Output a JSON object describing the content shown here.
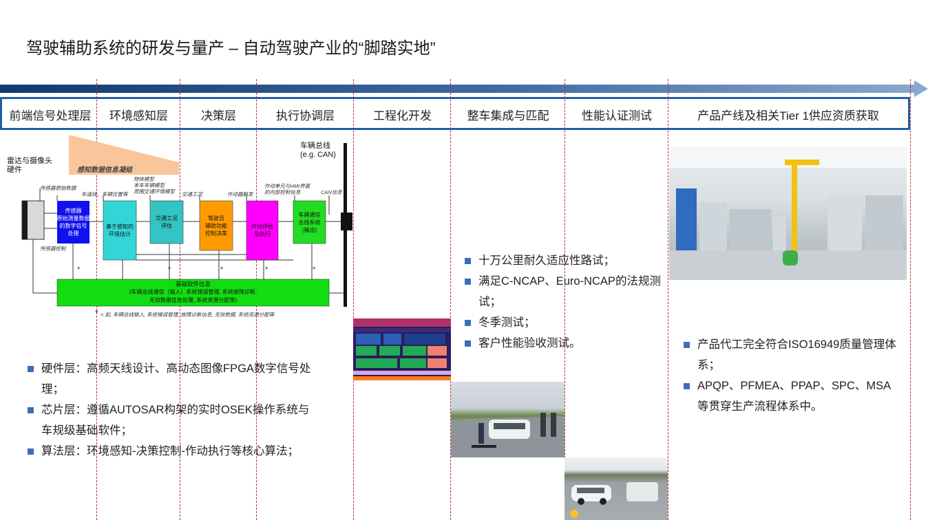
{
  "title": "驾驶辅助系统的研发与量产 – 自动驾驶产业的“脚踏实地”",
  "stages": [
    {
      "label": "前端信号处理层"
    },
    {
      "label": "环境感知层"
    },
    {
      "label": "决策层"
    },
    {
      "label": "执行协调层"
    },
    {
      "label": "工程化开发"
    },
    {
      "label": "整车集成与匹配"
    },
    {
      "label": "性能认证测试"
    },
    {
      "label": "产品产线及相关Tier 1供应资质获取"
    }
  ],
  "diagram": {
    "radar_label": "雷达与摄像头\n硬件",
    "bus_label": "车辆总线\n(e.g. CAN)",
    "fusion_label": "感知数据信息凝结",
    "sensor_raw": "传感器原始数据",
    "sensor_ctrl": "传感器控制",
    "lane_label": "车道线、车辆位置等",
    "object_label": "物体模型\n本车车辆模型\n周围交通环境模型",
    "traffic_label": "交通工况",
    "action_label": "作动器触发",
    "hmi_label": "作动单元与HMI界面\n的内部控制信息",
    "can_info": "CAN信息",
    "box1": "传感器\n原始测量数据\n的数字信号\n处理",
    "box2": "基于感知的\n环境估计",
    "box3": "交通工况\n评估",
    "box4": "驾驶员\n辅助功能\n控制决策",
    "box5": "作动评估\n及执行",
    "box6": "车辆通信\n总线系统\n(输出)",
    "base_title": "基础软件信息",
    "base_line1": "(车辆总线通信（输入）系统错误管理, 系统故障诊断,",
    "base_line2": "无效数据信息处理, 系统资源分配等)",
    "footnote": "= 如, 车辆总线输入, 系统错误管理, 故障诊断信息, 无效数据, 系统资源分配等",
    "star": "*"
  },
  "left_bullets": [
    "硬件层：高频天线设计、高动态图像FPGA数字信号处理；",
    "芯片层：遵循AUTOSAR构架的实时OSEK操作系统与车规级基础软件；",
    "算法层：环境感知-决策控制-作动执行等核心算法；"
  ],
  "mid_bullets": [
    "十万公里耐久适应性路试；",
    "满足C-NCAP、Euro-NCAP的法规测试；",
    "冬季测试；",
    "客户性能验收测试。"
  ],
  "right_bullets": [
    "产品代工完全符合ISO16949质量管理体系；",
    "APQP、PFMEA、PPAP、SPC、MSA等贯穿生产流程体系中。"
  ],
  "colors": {
    "accent": "#1f5fa8",
    "bullet": "#3d6db5",
    "divider": "#c0282d"
  }
}
